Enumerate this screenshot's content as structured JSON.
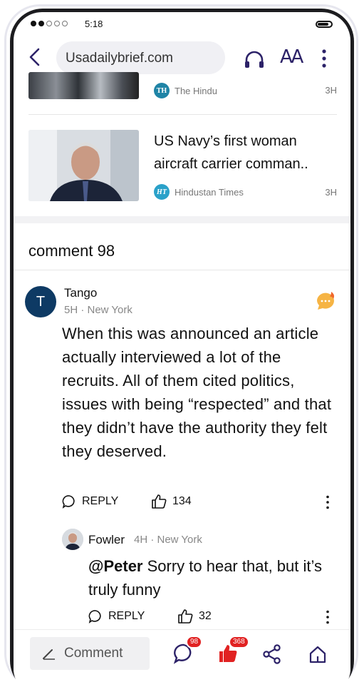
{
  "status": {
    "time": "5:18"
  },
  "browser": {
    "url": "Usadailybrief.com",
    "font_size_icon_label": "AA"
  },
  "news": [
    {
      "source": "The Hindu",
      "source_logo": "TH",
      "age": "3H"
    },
    {
      "title_line1": "US Navy’s first woman",
      "title_line2": "aircraft carrier  comman..",
      "source": "Hindustan Times",
      "source_logo": "HT",
      "age": "3H"
    }
  ],
  "comments_header": "comment 98",
  "comment": {
    "avatar_letter": "T",
    "user": "Tango",
    "meta": "5H · New York",
    "text": "When this was announced an article actually interviewed a lot of the recruits. All of them cited politics, issues with being “respected” and that they didn’t have the authority they felt they deserved.",
    "reply_label": "REPLY",
    "likes": "134"
  },
  "reply": {
    "user": "Fowler",
    "meta": "4H · New York",
    "mention": "@Peter",
    "text": " Sorry to hear that, but it’s truly funny",
    "reply_label": "REPLY",
    "likes": "32"
  },
  "bottom": {
    "comment_placeholder": "Comment",
    "comments_badge": "98",
    "likes_badge": "368"
  },
  "colors": {
    "accent": "#2c2268",
    "like_red": "#e12222",
    "avatar_blue": "#0e3a64"
  }
}
